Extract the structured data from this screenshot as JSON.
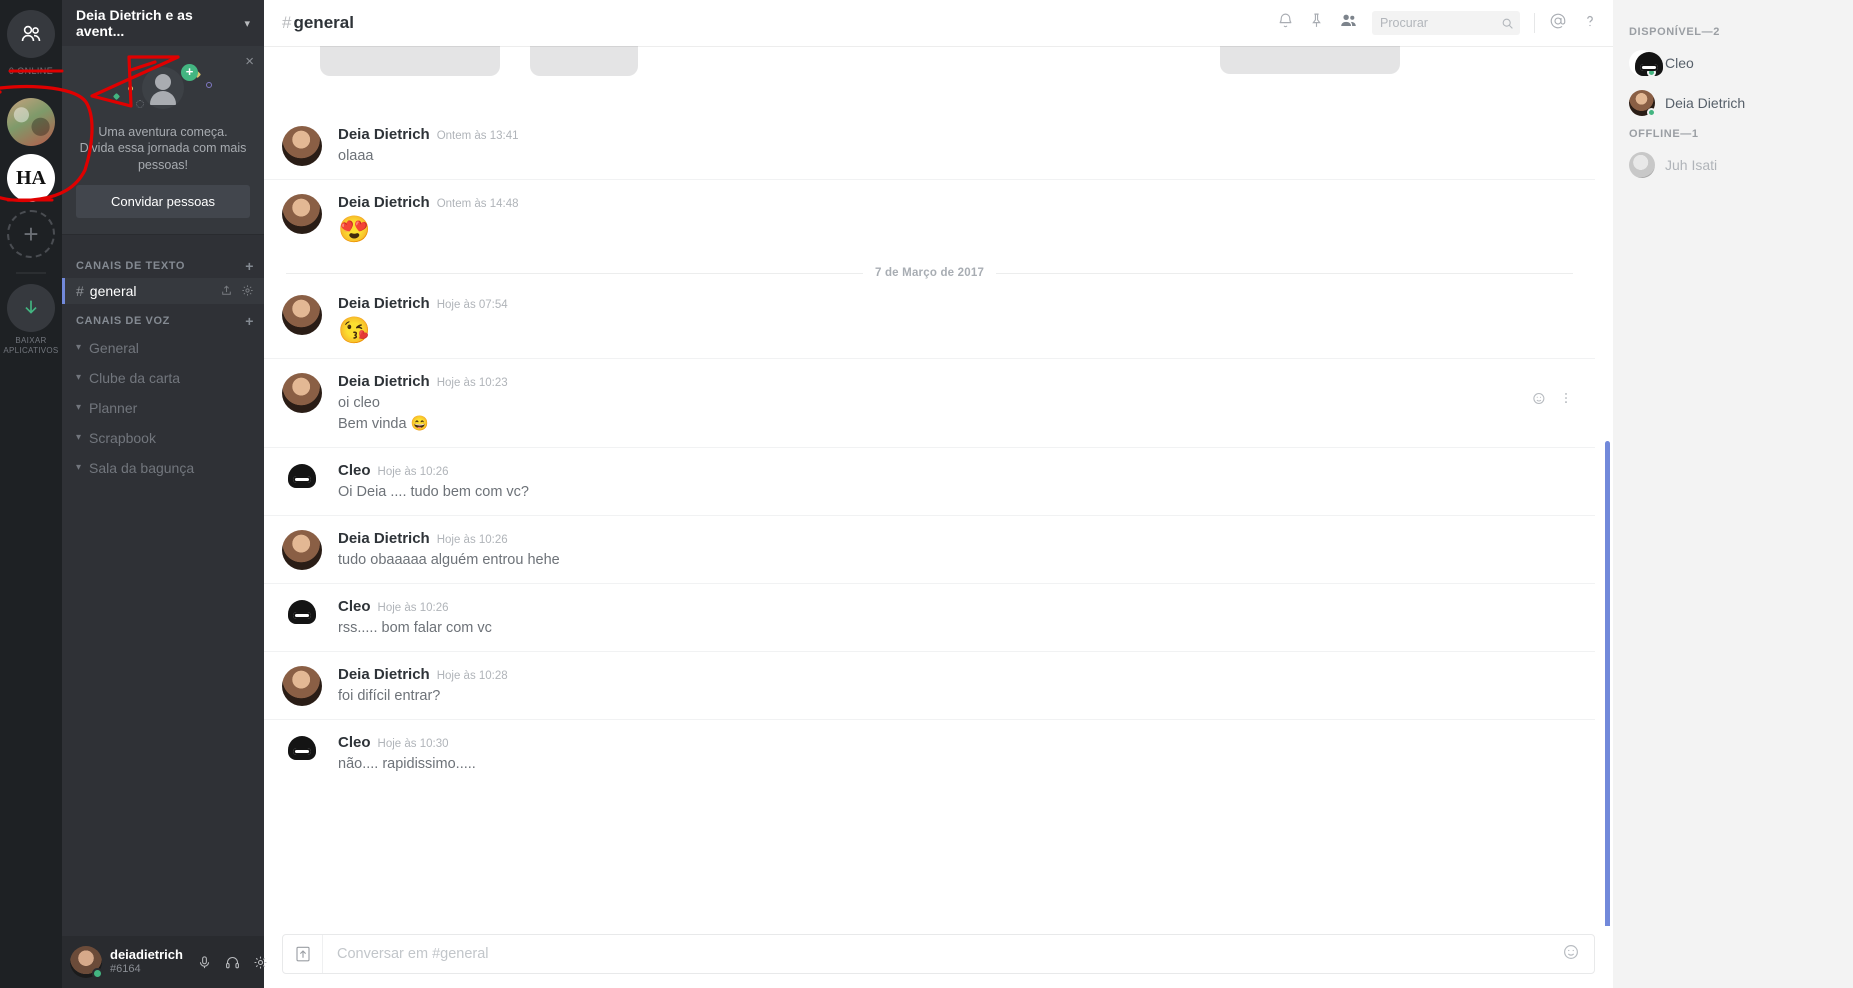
{
  "rail": {
    "home_icon": "friends-icon",
    "online_label": "0 ONLINE",
    "servers": [
      {
        "name": "Deia Dietrich e as aventuras",
        "badge": ""
      },
      {
        "name": "HA",
        "badge": "HA"
      }
    ],
    "add_server_label": "+",
    "download_label": "BAIXAR\nAPLICATIVOS",
    "download_line1": "BAIXAR",
    "download_line2": "APLICATIVOS"
  },
  "sidebar": {
    "server_name": "Deia Dietrich e as avent...",
    "chevron": "chevron-down-icon",
    "invite": {
      "close": "×",
      "title_line1": "Uma aventura começa.",
      "title_line2": "Divida essa jornada com mais",
      "title_line3": "pessoas!",
      "button": "Convidar pessoas"
    },
    "text_category": "CANAIS DE TEXTO",
    "voice_category": "CANAIS DE VOZ",
    "add_label": "+",
    "text_channels": [
      {
        "name": "general",
        "hash": "#",
        "active": true
      }
    ],
    "voice_channels": [
      {
        "name": "General"
      },
      {
        "name": "Clube da carta"
      },
      {
        "name": "Planner"
      },
      {
        "name": "Scrapbook"
      },
      {
        "name": "Sala da bagunça"
      }
    ],
    "user": {
      "name": "deiadietrich",
      "tag": "#6164",
      "status": "online",
      "mic_icon": "microphone-icon",
      "headset_icon": "headset-icon",
      "settings_icon": "gear-icon"
    }
  },
  "topbar": {
    "hash": "#",
    "channel": "general",
    "icons": {
      "bell": "bell-icon",
      "pin": "pin-icon",
      "members": "members-icon",
      "mentions": "mentions-icon",
      "help": "help-icon",
      "search": "search-icon"
    },
    "search_placeholder": "Procurar",
    "search_value": ""
  },
  "messages": {
    "date_divider": "7 de Março de 2017",
    "items": [
      {
        "author": "Deia Dietrich",
        "avatar": "deia",
        "time": "Ontem às 13:41",
        "lines": [
          "olaaa"
        ],
        "emoji": null
      },
      {
        "author": "Deia Dietrich",
        "avatar": "deia",
        "time": "Ontem às 14:48",
        "lines": [],
        "emoji": "😍"
      },
      {
        "author": "Deia Dietrich",
        "avatar": "deia",
        "time": "Hoje às 07:54",
        "lines": [],
        "emoji": "😘"
      },
      {
        "author": "Deia Dietrich",
        "avatar": "deia",
        "time": "Hoje às 10:23",
        "lines": [
          "oi cleo",
          "Bem vinda 😄"
        ],
        "emoji": null,
        "hovered": true
      },
      {
        "author": "Cleo",
        "avatar": "cleo",
        "time": "Hoje às 10:26",
        "lines": [
          "Oi Deia .... tudo bem com vc?"
        ],
        "emoji": null
      },
      {
        "author": "Deia Dietrich",
        "avatar": "deia",
        "time": "Hoje às 10:26",
        "lines": [
          "tudo obaaaaa alguém entrou hehe"
        ],
        "emoji": null
      },
      {
        "author": "Cleo",
        "avatar": "cleo",
        "time": "Hoje às 10:26",
        "lines": [
          "rss..... bom falar com vc"
        ],
        "emoji": null
      },
      {
        "author": "Deia Dietrich",
        "avatar": "deia",
        "time": "Hoje às 10:28",
        "lines": [
          "foi difícil entrar?"
        ],
        "emoji": null
      },
      {
        "author": "Cleo",
        "avatar": "cleo",
        "time": "Hoje às 10:30",
        "lines": [
          "não.... rapidissimo....."
        ],
        "emoji": null
      }
    ],
    "hover_actions": {
      "reaction": "add-reaction-icon",
      "more": "more-options-icon"
    }
  },
  "composer": {
    "upload_icon": "upload-icon",
    "placeholder": "Conversar em #general",
    "value": "",
    "emoji_icon": "emoji-picker-icon"
  },
  "members": {
    "online_header": "DISPONÍVEL—2",
    "offline_header": "OFFLINE—1",
    "online": [
      {
        "name": "Cleo",
        "avatar": "cleo"
      },
      {
        "name": "Deia Dietrich",
        "avatar": "deia"
      }
    ],
    "offline": [
      {
        "name": "Juh Isati",
        "avatar": "juh"
      }
    ]
  },
  "colors": {
    "accent": "#7289da",
    "online": "#43b581",
    "rail_bg": "#1e2124",
    "sidebar_bg": "#2f3136",
    "members_bg": "#f3f3f3",
    "annotation": "#e00000"
  }
}
